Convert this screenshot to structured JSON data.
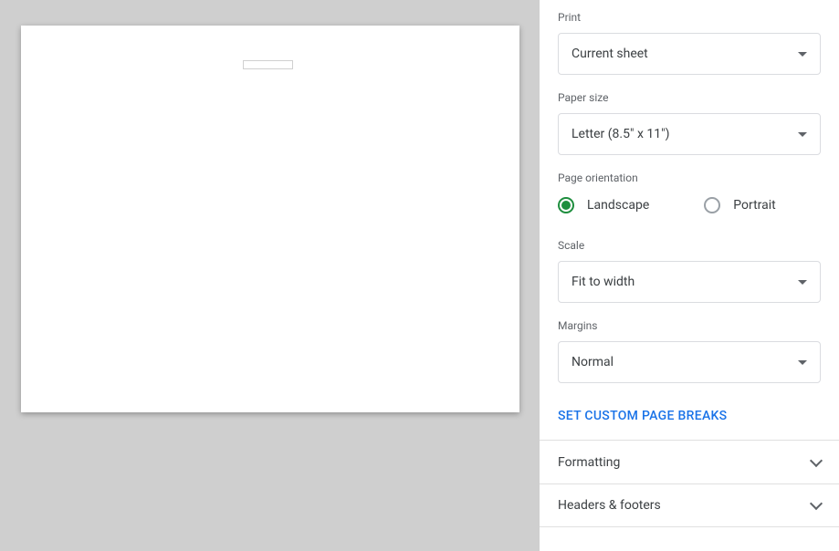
{
  "preview": {},
  "settings": {
    "print": {
      "label": "Print",
      "value": "Current sheet"
    },
    "paper_size": {
      "label": "Paper size",
      "value": "Letter (8.5\" x 11\")"
    },
    "orientation": {
      "label": "Page orientation",
      "landscape": "Landscape",
      "portrait": "Portrait",
      "selected": "landscape"
    },
    "scale": {
      "label": "Scale",
      "value": "Fit to width"
    },
    "margins": {
      "label": "Margins",
      "value": "Normal"
    },
    "custom_breaks_label": "SET CUSTOM PAGE BREAKS"
  },
  "expanders": {
    "formatting": "Formatting",
    "headers_footers": "Headers & footers"
  }
}
